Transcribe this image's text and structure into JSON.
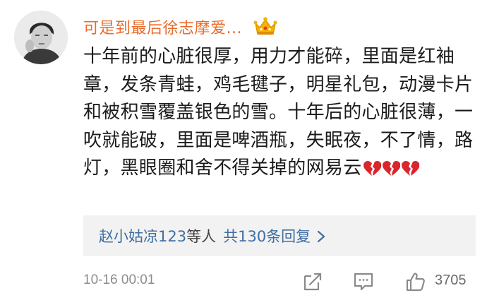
{
  "comment": {
    "username": "可是到最后徐志摩爱...",
    "badge_icon": "vip-crown-icon",
    "text": "十年前的心脏很厚，用力才能碎，里面是红袖章，发条青蛙，鸡毛毽子，明星礼包，动漫卡片和被积雪覆盖银色的雪。十年后的心脏很薄，一吹就能破，里面是啤酒瓶，失眠夜，不了情，路灯，黑眼圈和舍不得关掉的网易云",
    "emojis": [
      "broken-heart-icon",
      "broken-heart-icon",
      "broken-heart-icon"
    ],
    "replies": {
      "user": "赵小姑凉123",
      "suffix": "等人",
      "count_label": "共130条回复"
    },
    "timestamp": "10-16 00:01",
    "like_count": "3705"
  },
  "colors": {
    "username": "#e86c2b",
    "link": "#3f6ea3",
    "emoji": "#d9252c",
    "muted": "#8d8d8d"
  }
}
